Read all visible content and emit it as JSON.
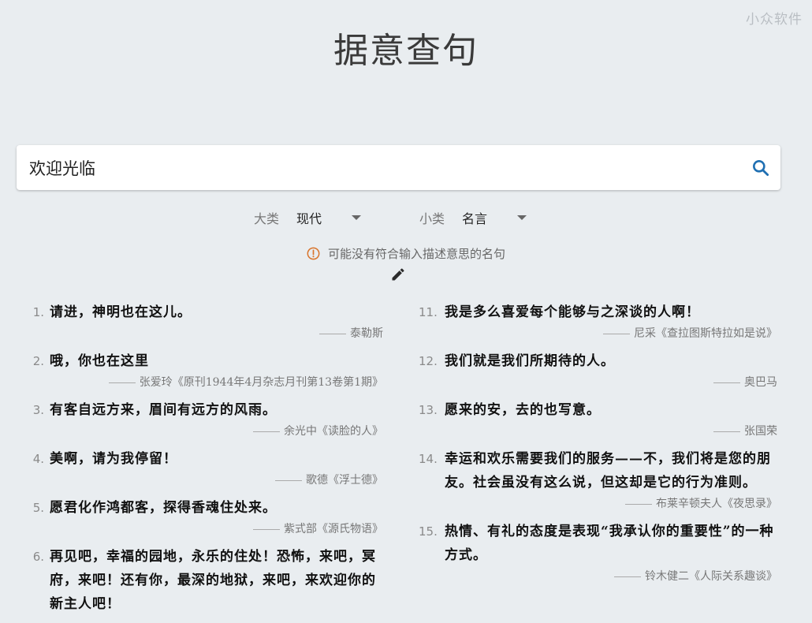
{
  "watermark": "小众软件",
  "title": "据意查句",
  "search": {
    "value": "欢迎光临"
  },
  "filters": {
    "major": {
      "label": "大类",
      "value": "现代"
    },
    "minor": {
      "label": "小类",
      "value": "名言"
    }
  },
  "notice": "可能没有符合输入描述意思的名句",
  "icons": {
    "search": "search-icon",
    "notice": "warning-circle-icon",
    "edit": "pencil-icon",
    "dropdown": "caret-down-icon"
  },
  "colors": {
    "background": "#e9edf0",
    "search_icon": "#1f6fb2",
    "notice_icon": "#d9742b"
  },
  "quotes_left": [
    {
      "num": "1.",
      "text": "请进，神明也在这儿。",
      "author": "泰勒斯"
    },
    {
      "num": "2.",
      "text": "哦，你也在这里",
      "author": "张爱玲《原刊1944年4月杂志月刊第13卷第1期》"
    },
    {
      "num": "3.",
      "text": "有客自远方来，眉间有远方的风雨。",
      "author": "余光中《读脸的人》"
    },
    {
      "num": "4.",
      "text": "美啊，请为我停留！",
      "author": "歌德《浮士德》"
    },
    {
      "num": "5.",
      "text": "愿君化作鸿都客，探得香魂住处来。",
      "author": "紫式部《源氏物语》"
    },
    {
      "num": "6.",
      "text": "再见吧，幸福的园地，永乐的住处！恐怖，来吧，冥府，来吧！还有你，最深的地狱，来吧，来欢迎你的新主人吧！",
      "author": ""
    }
  ],
  "quotes_right": [
    {
      "num": "11.",
      "text": "我是多么喜爱每个能够与之深谈的人啊！",
      "author": "尼采《查拉图斯特拉如是说》"
    },
    {
      "num": "12.",
      "text": "我们就是我们所期待的人。",
      "author": "奥巴马"
    },
    {
      "num": "13.",
      "text": "愿来的安，去的也写意。",
      "author": "张国荣"
    },
    {
      "num": "14.",
      "text": "幸运和欢乐需要我们的服务——不，我们将是您的朋友。社会虽没有这么说，但这却是它的行为准则。",
      "author": "布莱辛顿夫人《夜思录》"
    },
    {
      "num": "15.",
      "text": "热情、有礼的态度是表现“我承认你的重要性”的一种方式。",
      "author": "铃木健二《人际关系趣谈》"
    }
  ]
}
